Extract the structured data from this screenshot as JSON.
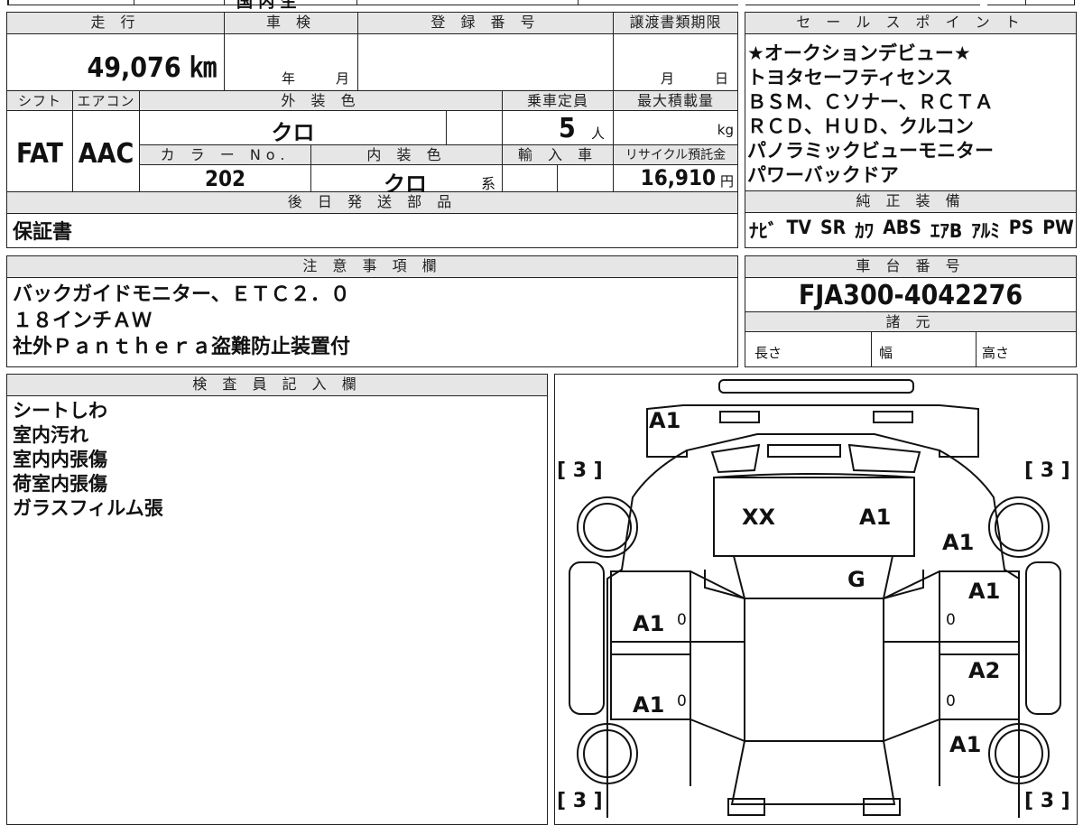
{
  "top_strip": {
    "partial_text": "国 内 生"
  },
  "mileage": {
    "label": "走 行",
    "value": "49,076 ㎞"
  },
  "inspection": {
    "label": "車 検",
    "year": "年",
    "month": "月"
  },
  "registration": {
    "label": "登 録 番 号",
    "value": ""
  },
  "transfer_deadline": {
    "label": "譲渡書類期限",
    "month": "月",
    "day": "日"
  },
  "shift": {
    "label": "シフト",
    "value": "FAT"
  },
  "aircon": {
    "label": "エアコン",
    "value": "AAC"
  },
  "exterior_color": {
    "label": "外 装 色",
    "value": "クロ"
  },
  "capacity": {
    "label": "乗車定員",
    "value": "5",
    "unit": "人"
  },
  "max_load": {
    "label": "最大積載量",
    "unit": "kg"
  },
  "color_no": {
    "label": "カ ラ ー No.",
    "value": "202"
  },
  "interior_color": {
    "label": "内 装 色",
    "value": "クロ",
    "suffix": "系"
  },
  "import": {
    "label": "輸 入 車"
  },
  "recycle": {
    "label": "リサイクル預託金",
    "value": "16,910",
    "unit": "円"
  },
  "later_parts": {
    "label": "後 日 発 送 部 品",
    "value": "保証書"
  },
  "sales_points": {
    "label": "セ ー ル ス ポ イ ン ト",
    "lines": [
      "★オークションデビュー★",
      "トヨタセーフティセンス",
      "ＢＳＭ、Ｃソナー、ＲＣＴＡ",
      "ＲＣＤ、ＨＵＤ、クルコン",
      "パノラミックビューモニター",
      "パワーバックドア"
    ]
  },
  "equipment": {
    "label": "純 正 装 備",
    "items": [
      "ﾅﾋﾞ",
      "TV",
      "SR",
      "ｶﾜ",
      "ABS",
      "ｴｱB",
      "ｱﾙﾐ",
      "PS",
      "PW"
    ]
  },
  "notes": {
    "label": "注 意 事 項 欄",
    "lines": [
      "バックガイドモニター、ＥＴＣ２．０",
      "１８インチＡＷ",
      "社外Ｐａｎｔｈｅｒａ盗難防止装置付"
    ]
  },
  "chassis": {
    "label": "車 台 番 号",
    "value": "FJA300-4042276"
  },
  "specs": {
    "label": "諸 元",
    "length": "長さ",
    "width": "幅",
    "height": "高さ"
  },
  "inspector": {
    "label": "検 査 員 記 入 欄",
    "lines": [
      "シートしわ",
      "室内汚れ",
      "室内内張傷",
      "荷室内張傷",
      "ガラスフィルム張"
    ]
  },
  "diagram": {
    "marks": {
      "rear_top": "A1",
      "roof_left": "XX",
      "roof_right": "A1",
      "right_rear_fender": "A1",
      "windshield": "G",
      "right_rear_door": "A1",
      "left_rear_door": "A1",
      "right_front_door": "A2",
      "left_front_door": "A1",
      "right_front_fender": "A1"
    },
    "zero": "0",
    "tire_tl": "[ 3 ]",
    "tire_tr": "[ 3 ]",
    "tire_bl": "[ 3 ]",
    "tire_br": "[ 3 ]"
  }
}
